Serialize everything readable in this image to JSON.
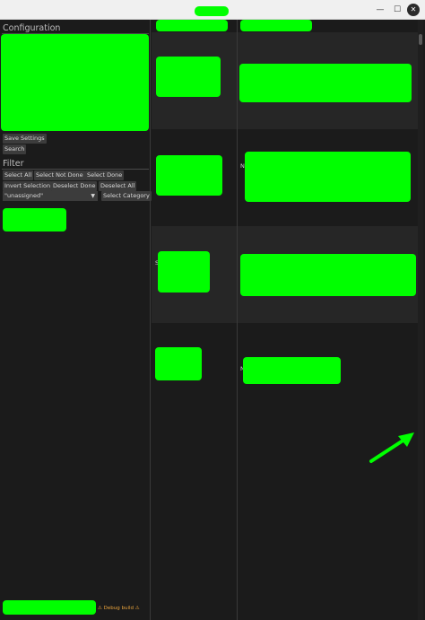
{
  "window": {
    "minimize_glyph": "—",
    "maximize_glyph": "☐",
    "close_glyph": "✕"
  },
  "sidebar": {
    "configuration_title": "Configuration",
    "save_settings_label": "Save Settings",
    "search_label": "Search",
    "filter_title": "Filter",
    "buttons": {
      "select_all": "Select All",
      "select_not_done": "Select Not Done",
      "select_done": "Select Done",
      "invert_selection": "Invert Selection",
      "deselect_done": "Deselect Done",
      "deselect_all": "Deselect All",
      "select_category": "Select Category"
    },
    "category_value": "\"unassigned\"",
    "debug_label": "⚠ Debug build ⚠"
  },
  "table": {
    "rows": [
      {
        "left_text": "",
        "right_text": ""
      },
      {
        "left_text": "",
        "right_text": "N"
      },
      {
        "left_text": "S",
        "right_text": ""
      },
      {
        "left_text": "",
        "right_text": "N"
      }
    ]
  },
  "colors": {
    "background": "#1b1b1b",
    "stripe": "#262626",
    "redaction": "#00ff00",
    "debug": "#e8a23c"
  }
}
